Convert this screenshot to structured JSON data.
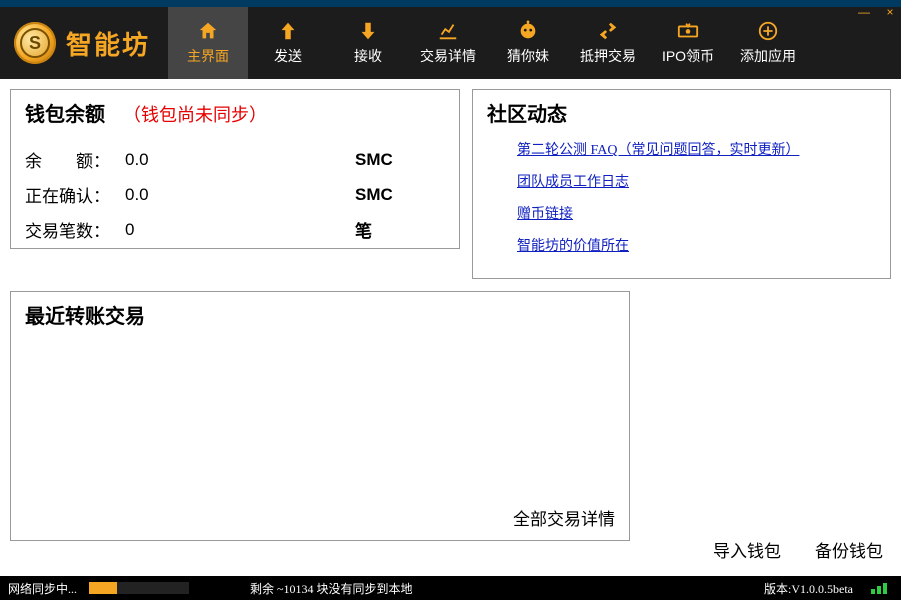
{
  "app": {
    "name": "智能坊",
    "logo_letter": "S"
  },
  "window": {
    "minimize": "—",
    "close": "×"
  },
  "nav": [
    {
      "label": "主界面",
      "icon": "home",
      "active": true
    },
    {
      "label": "发送",
      "icon": "arrow-up"
    },
    {
      "label": "接收",
      "icon": "arrow-down"
    },
    {
      "label": "交易详情",
      "icon": "chart"
    },
    {
      "label": "猜你妹",
      "icon": "robot"
    },
    {
      "label": "抵押交易",
      "icon": "exchange"
    },
    {
      "label": "IPO领币",
      "icon": "cash"
    },
    {
      "label": "添加应用",
      "icon": "plus"
    }
  ],
  "balance": {
    "title": "钱包余额",
    "not_synced": "（钱包尚未同步）",
    "rows": [
      {
        "label": "余　　额：",
        "value": "0.0",
        "unit": "SMC"
      },
      {
        "label": "正在确认：",
        "value": "0.0",
        "unit": "SMC"
      },
      {
        "label": "交易笔数：",
        "value": "0",
        "unit": "笔"
      }
    ]
  },
  "community": {
    "title": "社区动态",
    "links": [
      "第二轮公测 FAQ（常见问题回答，实时更新）",
      "团队成员工作日志",
      "赠币链接",
      "智能坊的价值所在"
    ]
  },
  "recent": {
    "title": "最近转账交易",
    "more": "全部交易详情"
  },
  "actions": {
    "import": "导入钱包",
    "backup": "备份钱包"
  },
  "status": {
    "sync": "网络同步中...",
    "progress_pct": 28,
    "remain": "剩余 ~10134 块没有同步到本地",
    "version": "版本:V1.0.0.5beta"
  }
}
